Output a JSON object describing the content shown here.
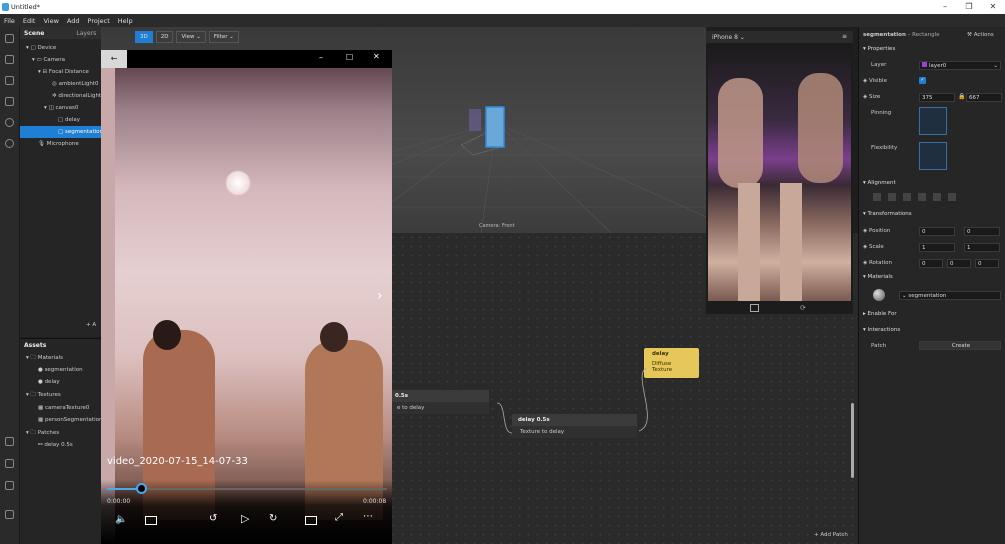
{
  "window": {
    "title": "Untitled*",
    "min": "–",
    "max": "❐",
    "close": "✕"
  },
  "menu": [
    "File",
    "Edit",
    "View",
    "Add",
    "Project",
    "Help"
  ],
  "scene": {
    "tab1": "Scene",
    "tab2": "Layers",
    "items": [
      "Device",
      "Camera",
      "Focal Distance",
      "ambientLight0",
      "directionalLight",
      "canvas0",
      "delay",
      "segmentation",
      "Microphone"
    ],
    "add": "+ A"
  },
  "assets": {
    "title": "Assets",
    "items": [
      "Materials",
      "segmentation",
      "delay",
      "Textures",
      "cameraTexture0",
      "personSegmentation",
      "Patches",
      "delay 0.5s"
    ]
  },
  "viewport": {
    "btn3d": "3D",
    "btn2d": "2D",
    "view": "View",
    "filter": "Filter",
    "camera_label": "Camera: Front"
  },
  "preview": {
    "device": "iPhone 8"
  },
  "patch": {
    "node1_title": "0.5s",
    "node1_input": "e to delay",
    "node2_title": "delay 0.5s",
    "node2_input": "Texture to delay",
    "node3_title": "delay",
    "node3_input": "Diffuse Texture",
    "add_patch": "+ Add Patch"
  },
  "props": {
    "object": "segmentation",
    "type": "– Rectangle",
    "actions": "Actions",
    "properties": "Properties",
    "layer_label": "Layer",
    "layer_value": "layer0",
    "visible": "Visible",
    "size": "Size",
    "size_w": "375",
    "size_h": "667",
    "pinning": "Pinning",
    "flexibility": "Flexibility",
    "alignment": "Alignment",
    "transformations": "Transformations",
    "position": "Position",
    "pos_x": "0",
    "pos_y": "0",
    "scale": "Scale",
    "scale_x": "1",
    "scale_y": "1",
    "rotation": "Rotation",
    "rot_x": "0",
    "rot_y": "0",
    "rot_z": "0",
    "materials": "Materials",
    "material_value": "segmentation",
    "enable_for": "Enable For",
    "interactions": "Interactions",
    "patch_label": "Patch",
    "create": "Create"
  },
  "player": {
    "filename": "video_2020-07-15_14-07-33",
    "time_current": "0:00:00",
    "time_total": "0:00:08",
    "progress": 0.12
  }
}
